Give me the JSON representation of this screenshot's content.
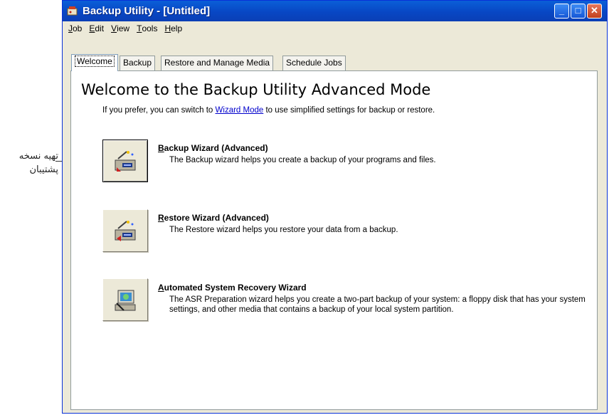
{
  "annotation": {
    "line1": "تهیه نسخه",
    "line2": "پشتیبان"
  },
  "window": {
    "title": "Backup Utility - [Untitled]",
    "controls": {
      "minimize": "_",
      "maximize": "□",
      "close": "✕"
    }
  },
  "menu": [
    {
      "key": "J",
      "rest": "ob"
    },
    {
      "key": "E",
      "rest": "dit"
    },
    {
      "key": "V",
      "rest": "iew"
    },
    {
      "key": "T",
      "rest": "ools"
    },
    {
      "key": "H",
      "rest": "elp"
    }
  ],
  "tabs": [
    "Welcome",
    "Backup",
    "Restore and Manage Media",
    "Schedule Jobs"
  ],
  "welcome": {
    "heading": "Welcome to the Backup Utility Advanced Mode",
    "sub_before": "If you prefer, you can switch to ",
    "sub_link": "Wizard Mode",
    "sub_after": " to use simplified settings for backup or restore."
  },
  "wizards": [
    {
      "key": "B",
      "title_rest": "ackup Wizard (Advanced)",
      "desc": "The Backup wizard helps you create a backup of your programs and files.",
      "icon": "backup-wizard-icon"
    },
    {
      "key": "R",
      "title_rest": "estore Wizard (Advanced)",
      "desc": "The Restore wizard helps you restore your data from a backup.",
      "icon": "restore-wizard-icon"
    },
    {
      "key": "A",
      "title_rest": "utomated System Recovery Wizard",
      "desc": "The ASR Preparation wizard helps you create a two-part backup of your system: a floppy disk that has your system settings, and other media that contains a backup of your local system partition.",
      "icon": "asr-wizard-icon"
    }
  ],
  "colors": {
    "titlebar": "#0a5fd8",
    "face": "#ece9d8",
    "link": "#0000cc"
  }
}
